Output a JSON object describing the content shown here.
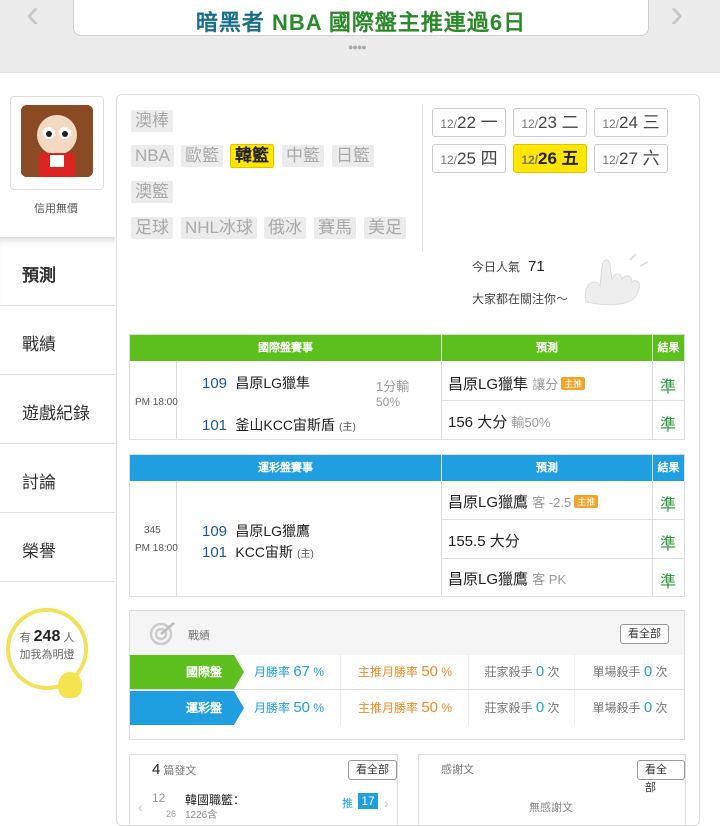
{
  "header": {
    "title_prefix": "暗黑者",
    "title": "NBA 國際盤主推連過6日",
    "prev_icon": "chevron-left-icon",
    "next_icon": "chevron-right-icon"
  },
  "profile": {
    "credit": "信用無價"
  },
  "side_tabs": [
    "預測",
    "戰績",
    "遊戲紀錄",
    "討論",
    "榮譽"
  ],
  "fans": {
    "prefix": "有",
    "count": "248",
    "suffix": "人",
    "line2": "加我為明燈"
  },
  "categories": {
    "row1": [
      "澳棒"
    ],
    "row2": [
      "NBA",
      "歐籃",
      "韓籃",
      "中籃",
      "日籃"
    ],
    "row3": [
      "澳籃"
    ],
    "row4": [
      "足球",
      "NHL冰球",
      "俄冰",
      "賽馬",
      "美足"
    ],
    "active": "韓籃"
  },
  "dates": [
    {
      "md": "12/",
      "d": "22",
      "w": "一"
    },
    {
      "md": "12/",
      "d": "23",
      "w": "二"
    },
    {
      "md": "12/",
      "d": "24",
      "w": "三"
    },
    {
      "md": "12/",
      "d": "25",
      "w": "四"
    },
    {
      "md": "12/",
      "d": "26",
      "w": "五"
    },
    {
      "md": "12/",
      "d": "27",
      "w": "六"
    }
  ],
  "popularity": {
    "label": "今日人氣",
    "value": "71",
    "line2": "大家都在關注你～"
  },
  "intl": {
    "headers": [
      "國際盤賽事",
      "預測",
      "結果"
    ],
    "time": "PM 18:00",
    "home_no": "109",
    "home": "昌原LG獵隼",
    "away_no": "101",
    "away": "釜山KCC宙斯盾",
    "away_tag": "(主)",
    "line": "1分輸",
    "line2": "50%",
    "pred1_team": "昌原LG獵隼",
    "pred1_extra": "讓分",
    "pred1_tag": "主推",
    "pred2": "156 大分",
    "pred2_extra": "輸50%",
    "result1": "準",
    "result2": "準"
  },
  "lottery": {
    "headers": [
      "運彩盤賽事",
      "預測",
      "結果"
    ],
    "game_no": "345",
    "time": "PM 18:00",
    "home_no": "109",
    "home": "昌原LG獵鷹",
    "away_no": "101",
    "away": "KCC宙斯",
    "away_tag": "(主)",
    "pred1_team": "昌原LG獵鷹",
    "pred1_extra": "客 -2.5",
    "pred1_tag": "主推",
    "pred2": "155.5 大分",
    "pred3_team": "昌原LG獵鷹",
    "pred3_extra": "客 PK",
    "results": [
      "準",
      "準",
      "準"
    ]
  },
  "record": {
    "title": "戰績",
    "view_all": "看全部",
    "rows": [
      {
        "label": "國際盤",
        "m_label": "月勝率",
        "m": "67",
        "mm_label": "主推月勝率",
        "mm": "50",
        "k_label": "莊家殺手",
        "k": "0",
        "s_label": "單場殺手",
        "s": "0"
      },
      {
        "label": "運彩盤",
        "m_label": "月勝率",
        "m": "50",
        "mm_label": "主推月勝率",
        "mm": "50",
        "k_label": "莊家殺手",
        "k": "0",
        "s_label": "單場殺手",
        "s": "0"
      }
    ],
    "pct": "%",
    "times": "次"
  },
  "posts": {
    "count": "4",
    "label": "篇發文",
    "view_all": "看全部",
    "month": "12",
    "day": "26",
    "item_title": "韓國職籃：",
    "item_sub": "1226含",
    "push": "推",
    "push_count": "17"
  },
  "thanks": {
    "label": "感謝文",
    "view_all": "看全部",
    "empty": "無感謝文"
  },
  "colors": {
    "green": "#5cbf1c",
    "blue": "#1f9ee0",
    "highlight": "#ffe600",
    "orange": "#f08a24"
  }
}
